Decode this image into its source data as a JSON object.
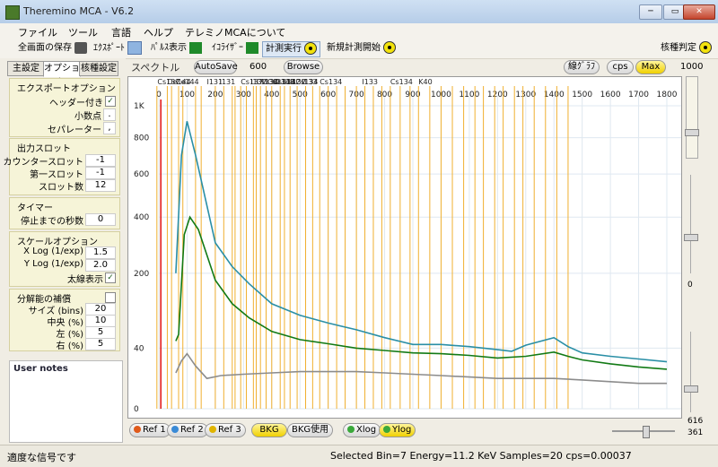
{
  "window": {
    "title": "Theremino MCA - V6.2",
    "minimize": "─",
    "maximize": "▭",
    "close": "✕"
  },
  "menu": [
    "ファイル",
    "ツール",
    "言語",
    "ヘルプ",
    "テレミノMCAについて"
  ],
  "toolbar": {
    "screen_save": "全画面の保存",
    "export": "ｴｸｽﾎﾟｰﾄ",
    "pulse": "ﾊﾟﾙｽ表示",
    "equalizer": "ｲｺﾗｲｻﾞｰ",
    "run": "計測実行",
    "new_measure": "新規計測開始",
    "nuclide_id": "核種判定"
  },
  "left_tabs": [
    "主設定",
    "オプション",
    "核種設定"
  ],
  "export_options": {
    "title": "エクスポートオプション",
    "header_label": "ヘッダー付き",
    "header_checked": "✓",
    "decimal_label": "小数点",
    "decimal_value": ".",
    "separator_label": "セパレーター",
    "separator_value": ","
  },
  "output_slots": {
    "title": "出力スロット",
    "counter_label": "カウンタースロット",
    "counter_value": "-1",
    "first_label": "第一スロット",
    "first_value": "-1",
    "num_label": "スロット数",
    "num_value": "12"
  },
  "timer": {
    "title": "タイマー",
    "stop_label": "停止までの秒数",
    "stop_value": "0"
  },
  "scale_options": {
    "title": "スケールオプション",
    "xlog_label": "X Log (1/exp)",
    "xlog_value": "1.5",
    "ylog_label": "Y Log (1/exp)",
    "ylog_value": "2.0",
    "thick_label": "太線表示",
    "thick_checked": "✓"
  },
  "resolution": {
    "title": "分解能の補償",
    "size_label": "サイズ (bins)",
    "size_value": "20",
    "center_label": "中央 (%)",
    "center_value": "10",
    "left_label": "左 (%)",
    "left_value": "5",
    "right_label": "右 (%)",
    "right_value": "5"
  },
  "notes": {
    "title": "User notes"
  },
  "spectrum_bar": {
    "label": "スペクトル",
    "autosave": "AutoSave",
    "autosave_value": "600",
    "browse": "Browse",
    "line_graph": "線ｸﾞﾗﾌ",
    "cps": "cps",
    "max": "Max",
    "max_value": "1000"
  },
  "chart_data": {
    "type": "line",
    "x_ticks": [
      0,
      100,
      200,
      300,
      400,
      500,
      600,
      700,
      800,
      900,
      1000,
      1100,
      1200,
      1300,
      1400,
      1500,
      1600,
      1700,
      1800
    ],
    "y_ticks": [
      "1K",
      "800",
      "600",
      "400",
      "200",
      "40",
      "0"
    ],
    "y_log_exp": 2.0,
    "x_log_exp": 1.5,
    "isotope_labels": [
      "Cs137",
      "De144",
      "Ce144",
      "I131",
      "I131",
      "Cs137",
      "I132",
      "Cs134",
      "I133",
      "Cs134",
      "Cs134",
      "I133",
      "I132",
      "I132",
      "Cs134",
      "I133",
      "Cs134",
      "I133",
      "Cs134",
      "K40"
    ],
    "series": [
      {
        "color": "#2a8fa6",
        "points": [
          [
            60,
            200
          ],
          [
            80,
            700
          ],
          [
            100,
            900
          ],
          [
            130,
            700
          ],
          [
            200,
            300
          ],
          [
            260,
            220
          ],
          [
            320,
            170
          ],
          [
            400,
            120
          ],
          [
            500,
            95
          ],
          [
            600,
            80
          ],
          [
            700,
            68
          ],
          [
            800,
            55
          ],
          [
            900,
            45
          ],
          [
            1000,
            45
          ],
          [
            1100,
            42
          ],
          [
            1200,
            38
          ],
          [
            1250,
            36
          ],
          [
            1300,
            44
          ],
          [
            1400,
            55
          ],
          [
            1450,
            42
          ],
          [
            1500,
            34
          ],
          [
            1600,
            30
          ],
          [
            1700,
            27
          ],
          [
            1800,
            24
          ]
        ]
      },
      {
        "color": "#127a15",
        "points": [
          [
            60,
            50
          ],
          [
            70,
            60
          ],
          [
            90,
            330
          ],
          [
            110,
            400
          ],
          [
            140,
            350
          ],
          [
            200,
            180
          ],
          [
            260,
            120
          ],
          [
            320,
            90
          ],
          [
            400,
            65
          ],
          [
            500,
            52
          ],
          [
            600,
            46
          ],
          [
            700,
            40
          ],
          [
            800,
            37
          ],
          [
            900,
            34
          ],
          [
            1000,
            33
          ],
          [
            1100,
            31
          ],
          [
            1200,
            28
          ],
          [
            1300,
            30
          ],
          [
            1400,
            35
          ],
          [
            1450,
            30
          ],
          [
            1500,
            26
          ],
          [
            1600,
            22
          ],
          [
            1700,
            19
          ],
          [
            1800,
            17
          ]
        ]
      },
      {
        "color": "#8c8c8c",
        "points": [
          [
            60,
            14
          ],
          [
            80,
            25
          ],
          [
            100,
            33
          ],
          [
            130,
            20
          ],
          [
            170,
            10
          ],
          [
            220,
            12
          ],
          [
            300,
            13
          ],
          [
            400,
            14
          ],
          [
            500,
            15
          ],
          [
            600,
            15
          ],
          [
            700,
            15
          ],
          [
            800,
            14
          ],
          [
            900,
            13
          ],
          [
            1000,
            12
          ],
          [
            1100,
            11
          ],
          [
            1200,
            10
          ],
          [
            1300,
            10
          ],
          [
            1400,
            10
          ],
          [
            1500,
            9
          ],
          [
            1600,
            8
          ],
          [
            1700,
            7
          ],
          [
            1800,
            7
          ]
        ]
      }
    ],
    "selection_line_x": 7,
    "isotope_lines_x": [
      -7,
      30,
      45,
      70,
      85,
      130,
      150,
      200,
      230,
      260,
      270,
      290,
      310,
      335,
      345,
      360,
      380,
      400,
      430,
      445,
      465,
      490,
      520,
      545,
      570,
      600,
      630,
      660,
      700,
      730,
      760,
      790,
      820,
      855,
      890,
      920,
      960,
      1000,
      1040,
      1080,
      1120,
      1150,
      1190,
      1220,
      1260,
      1290,
      1330,
      1370,
      1410,
      1450
    ]
  },
  "bottom_buttons": {
    "ref1": "Ref 1",
    "ref2": "Ref 2",
    "ref3": "Ref 3",
    "bkg": "BKG",
    "bkg_use": "BKG使用",
    "xlog": "Xlog",
    "ylog": "Ylog"
  },
  "right_slider": {
    "value_mid": "0",
    "val616": "616",
    "val361": "361"
  },
  "status": {
    "signal": "適度な信号です",
    "selected": "Selected Bin=7  Energy=11.2 KeV  Samples=20  cps=0.00037"
  }
}
